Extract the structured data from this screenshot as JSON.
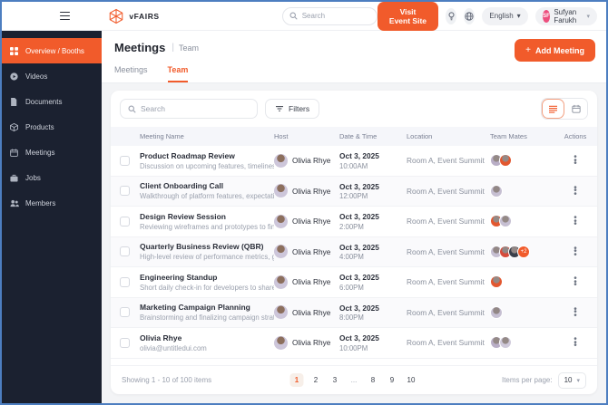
{
  "colors": {
    "accent": "#F15B2B",
    "sidebar_bg": "#1B2130",
    "frame_border": "#4D7EC0",
    "user_avatar_bg": "#ED4F7E",
    "table_header_bg": "#F5F6FA"
  },
  "topbar": {
    "brand": "vFAIRS",
    "search_placeholder": "Search",
    "visit_button_label": "Visit Event Site",
    "language": "English",
    "user": {
      "initials": "SF",
      "name": "Sufyan Farukh"
    }
  },
  "sidebar": {
    "items": [
      {
        "label": "Overview / Booths",
        "icon": "grid-icon",
        "active": true
      },
      {
        "label": "Videos",
        "icon": "play-icon",
        "active": false
      },
      {
        "label": "Documents",
        "icon": "document-icon",
        "active": false
      },
      {
        "label": "Products",
        "icon": "box-icon",
        "active": false
      },
      {
        "label": "Meetings",
        "icon": "calendar-icon",
        "active": false
      },
      {
        "label": "Jobs",
        "icon": "briefcase-icon",
        "active": false
      },
      {
        "label": "Members",
        "icon": "people-icon",
        "active": false
      }
    ]
  },
  "page": {
    "title": "Meetings",
    "breadcrumb_separator": "|",
    "breadcrumb": "Team",
    "add_meeting_label": "Add Meeting",
    "add_meeting_plus": "+",
    "tabs": [
      {
        "label": "Meetings",
        "active": false
      },
      {
        "label": "Team",
        "active": true
      }
    ]
  },
  "toolbar": {
    "search_placeholder": "Search",
    "filters_label": "Filters"
  },
  "table": {
    "columns": [
      "Meeting Name",
      "Host",
      "Date & Time",
      "Location",
      "Team Mates",
      "Actions"
    ],
    "rows": [
      {
        "title": "Product Roadmap Review",
        "subtitle": "Discussion on upcoming features, timelines,...",
        "host": "Olivia Rhye",
        "date": "Oct 3, 2025",
        "time": "10:00AM",
        "location": "Room A, Event Summit",
        "mates": [
          "#b9aec6",
          "#e2572f"
        ],
        "extra": ""
      },
      {
        "title": "Client Onboarding Call",
        "subtitle": "Walkthrough of platform features, expectati...",
        "host": "Olivia Rhye",
        "date": "Oct 3, 2025",
        "time": "12:00PM",
        "location": "Room A, Event Summit",
        "mates": [
          "#c6bfd2"
        ],
        "extra": ""
      },
      {
        "title": "Design Review Session",
        "subtitle": "Reviewing wireframes and prototypes to fin...",
        "host": "Olivia Rhye",
        "date": "Oct 3, 2025",
        "time": "2:00PM",
        "location": "Room A, Event Summit",
        "mates": [
          "#e2572f",
          "#c6bfd2"
        ],
        "extra": ""
      },
      {
        "title": "Quarterly Business Review (QBR)",
        "subtitle": "High-level review of performance metrics, g...",
        "host": "Olivia Rhye",
        "date": "Oct 3, 2025",
        "time": "4:00PM",
        "location": "Room A, Event Summit",
        "mates": [
          "#c6bfd2",
          "#d64a3a",
          "#3a3f4a"
        ],
        "extra": "+2"
      },
      {
        "title": "Engineering Standup",
        "subtitle": "Short daily check-in for developers to share...",
        "host": "Olivia Rhye",
        "date": "Oct 3, 2025",
        "time": "6:00PM",
        "location": "Room A, Event Summit",
        "mates": [
          "#e2572f"
        ],
        "extra": ""
      },
      {
        "title": "Marketing Campaign Planning",
        "subtitle": "Brainstorming and finalizing campaign strat...",
        "host": "Olivia Rhye",
        "date": "Oct 3, 2025",
        "time": "8:00PM",
        "location": "Room A, Event Summit",
        "mates": [
          "#c6bfd2"
        ],
        "extra": ""
      },
      {
        "title": "Olivia Rhye",
        "subtitle": "olivia@untitledui.com",
        "host": "Olivia Rhye",
        "date": "Oct 3, 2025",
        "time": "10:00PM",
        "location": "Room A, Event Summit",
        "mates": [
          "#b9aec6",
          "#cfc9da"
        ],
        "extra": ""
      }
    ]
  },
  "footer": {
    "showing": "Showing 1 - 10 of 100 items",
    "pages": [
      "1",
      "2",
      "3",
      "...",
      "8",
      "9",
      "10"
    ],
    "active_page": "1",
    "items_per_page_label": "Items per page:",
    "items_per_page_value": "10"
  }
}
